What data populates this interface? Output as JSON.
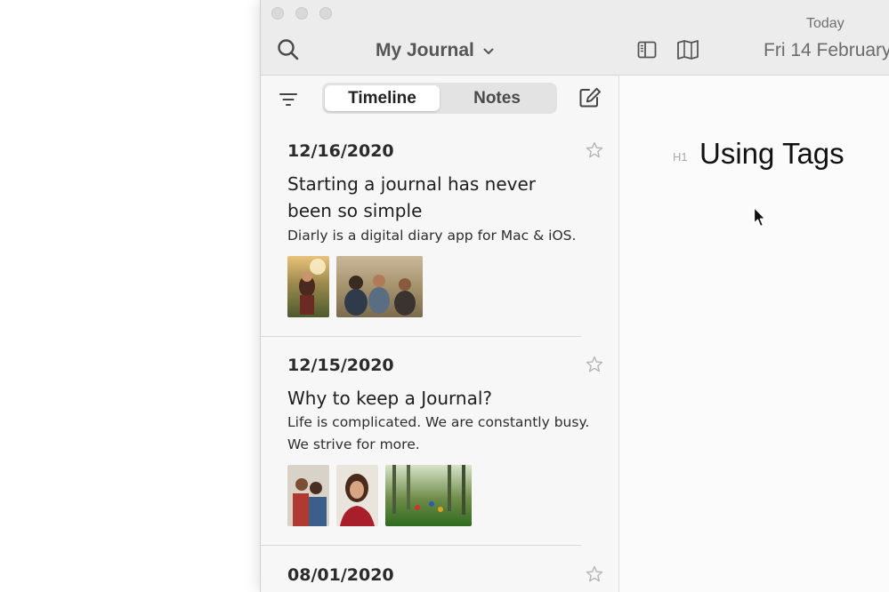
{
  "toolbar": {
    "journal_name": "My Journal",
    "today_label": "Today",
    "current_date": "Fri 14 February"
  },
  "list": {
    "tabs": [
      {
        "label": "Timeline",
        "active": true
      },
      {
        "label": "Notes",
        "active": false
      }
    ],
    "entries": [
      {
        "date": "12/16/2020",
        "title": "Starting a journal has never been so simple",
        "excerpt": "Diarly is a digital diary app for Mac & iOS.",
        "starred": false
      },
      {
        "date": "12/15/2020",
        "title": "Why to keep a Journal?",
        "excerpt": "Life is complicated. We are constantly busy. We strive for more.",
        "starred": false
      },
      {
        "date": "08/01/2020",
        "starred": false
      }
    ]
  },
  "editor": {
    "heading_marker": "H1",
    "document_title": "Using Tags"
  },
  "icons": [
    "search-icon",
    "chevron-down-icon",
    "sidebar-icon",
    "map-icon",
    "filter-icon",
    "compose-icon",
    "star-icon",
    "mouse-cursor-icon"
  ],
  "colors": {
    "window_background": "#f7f7f7",
    "titlebar_background": "#ececec",
    "segment_active": "#ffffff",
    "segment_track": "#e3e3e3",
    "text_primary": "#1c1c1c",
    "text_muted": "#6b6b6b"
  }
}
